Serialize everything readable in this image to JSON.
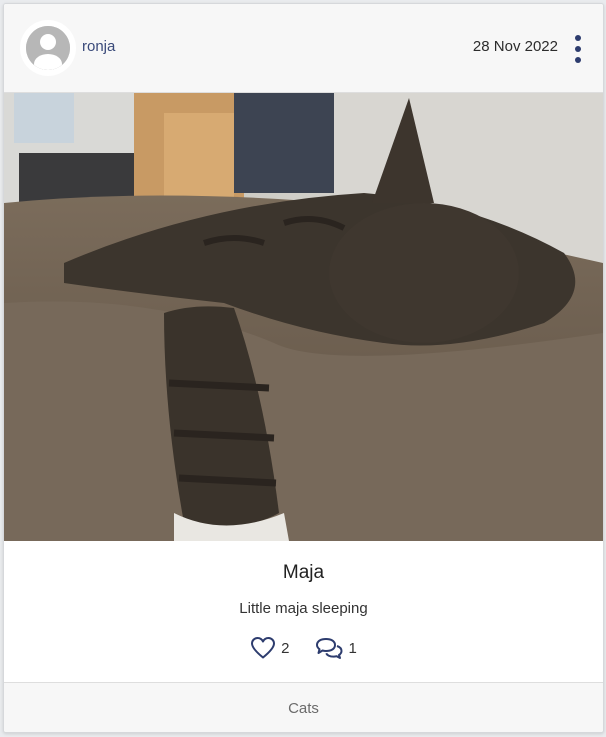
{
  "post": {
    "username": "ronja",
    "date": "28 Nov 2022",
    "title": "Maja",
    "description": "Little maja sleeping",
    "likes": "2",
    "comments": "1",
    "category": "Cats"
  },
  "icons": {
    "avatar": "default-avatar-icon",
    "menu": "more-vertical-icon",
    "like": "heart-outline-icon",
    "comment": "comments-icon"
  },
  "colors": {
    "accent": "#2d3c6e",
    "username": "#3a4a7a",
    "header_bg": "#f7f7f7"
  }
}
